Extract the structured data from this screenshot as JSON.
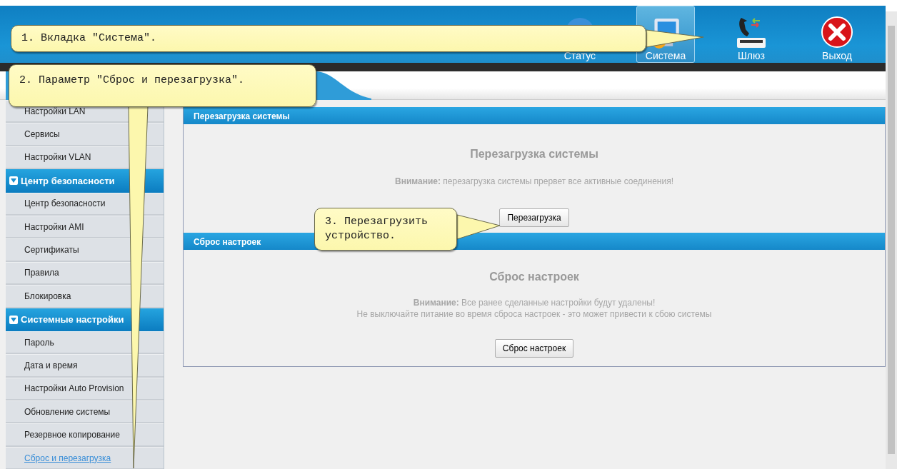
{
  "header": {
    "nav": [
      {
        "label": "Статус",
        "kind": "globe",
        "selected": false
      },
      {
        "label": "Система",
        "kind": "monitor",
        "selected": true
      },
      {
        "label": "Шлюз",
        "kind": "gateway",
        "selected": false
      },
      {
        "label": "Выход",
        "kind": "exit",
        "selected": false
      }
    ]
  },
  "sidebar": {
    "items": [
      {
        "label": "Настройки LAN",
        "kind": "item",
        "selected": false
      },
      {
        "label": "Сервисы",
        "kind": "item",
        "selected": false
      },
      {
        "label": "Настройки VLAN",
        "kind": "item",
        "selected": false
      },
      {
        "label": "Центр безопасности",
        "kind": "group",
        "expanded": true
      },
      {
        "label": "Центр безопасности",
        "kind": "item",
        "selected": false
      },
      {
        "label": "Настройки AMI",
        "kind": "item",
        "selected": false
      },
      {
        "label": "Сертификаты",
        "kind": "item",
        "selected": false
      },
      {
        "label": "Правила",
        "kind": "item",
        "selected": false
      },
      {
        "label": "Блокировка",
        "kind": "item",
        "selected": false
      },
      {
        "label": "Системные настройки",
        "kind": "group",
        "expanded": true
      },
      {
        "label": "Пароль",
        "kind": "item",
        "selected": false
      },
      {
        "label": "Дата и время",
        "kind": "item",
        "selected": false
      },
      {
        "label": "Настройки Auto Provision",
        "kind": "item",
        "selected": false
      },
      {
        "label": "Обновление системы",
        "kind": "item",
        "selected": false
      },
      {
        "label": "Резервное копирование",
        "kind": "item",
        "selected": false
      },
      {
        "label": "Сброс и перезагрузка",
        "kind": "item",
        "selected": true
      }
    ]
  },
  "panels": [
    {
      "header": "Перезагрузка системы",
      "title": "Перезагрузка системы",
      "notes": [
        "**Внимание:** перезагрузка системы прервет все активные соединения!"
      ],
      "button": "Перезагрузка"
    },
    {
      "header": "Сброс настроек",
      "title": "Сброс настроек",
      "notes": [
        "**Внимание:** Все ранее сделанные настройки будут удалены!",
        "Не выключайте питание во время сброса настроек - это может привести к сбою системы"
      ],
      "button": "Сброс настроек"
    }
  ],
  "annotations": [
    {
      "text": "1. Вкладка \"Система\"."
    },
    {
      "text": "2. Параметр \"Сброс и перезагрузка\"."
    },
    {
      "text": "3. Перезагрузить устройство."
    }
  ]
}
